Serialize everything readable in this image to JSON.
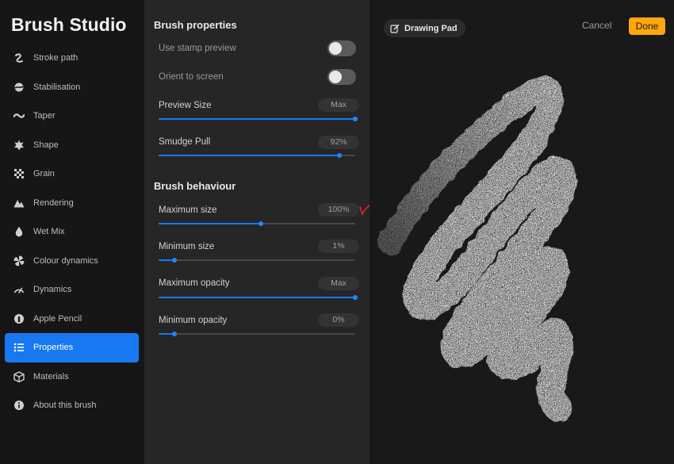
{
  "app": {
    "title": "Brush Studio"
  },
  "sidebar": {
    "items": [
      {
        "label": "Stroke path",
        "icon": "stroke-path-icon"
      },
      {
        "label": "Stabilisation",
        "icon": "stabilisation-icon"
      },
      {
        "label": "Taper",
        "icon": "taper-icon"
      },
      {
        "label": "Shape",
        "icon": "shape-icon"
      },
      {
        "label": "Grain",
        "icon": "grain-icon"
      },
      {
        "label": "Rendering",
        "icon": "rendering-icon"
      },
      {
        "label": "Wet Mix",
        "icon": "wet-mix-icon"
      },
      {
        "label": "Colour dynamics",
        "icon": "colour-dynamics-icon"
      },
      {
        "label": "Dynamics",
        "icon": "dynamics-icon"
      },
      {
        "label": "Apple Pencil",
        "icon": "apple-pencil-icon"
      },
      {
        "label": "Properties",
        "icon": "properties-icon",
        "active": true
      },
      {
        "label": "Materials",
        "icon": "materials-icon"
      },
      {
        "label": "About this brush",
        "icon": "info-icon"
      }
    ]
  },
  "properties": {
    "title": "Brush properties",
    "use_stamp_preview": {
      "label": "Use stamp preview",
      "enabled": false
    },
    "orient_to_screen": {
      "label": "Orient to screen",
      "enabled": false
    },
    "preview_size": {
      "label": "Preview Size",
      "value": "Max",
      "level": 1.0
    },
    "smudge_pull": {
      "label": "Smudge Pull",
      "value": "92%",
      "level": 0.92
    }
  },
  "behaviour": {
    "title": "Brush behaviour",
    "maximum_size": {
      "label": "Maximum size",
      "value": "100%",
      "level": 0.52
    },
    "minimum_size": {
      "label": "Minimum size",
      "value": "1%",
      "level": 0.08
    },
    "maximum_opacity": {
      "label": "Maximum opacity",
      "value": "Max",
      "level": 1.0
    },
    "minimum_opacity": {
      "label": "Minimum opacity",
      "value": "0%",
      "level": 0.08
    }
  },
  "pad": {
    "title": "Drawing Pad",
    "cancel_label": "Cancel",
    "done_label": "Done"
  },
  "colors": {
    "accent": "#1778f2",
    "done": "#ffa60a",
    "checkmark": "#e0282e"
  }
}
